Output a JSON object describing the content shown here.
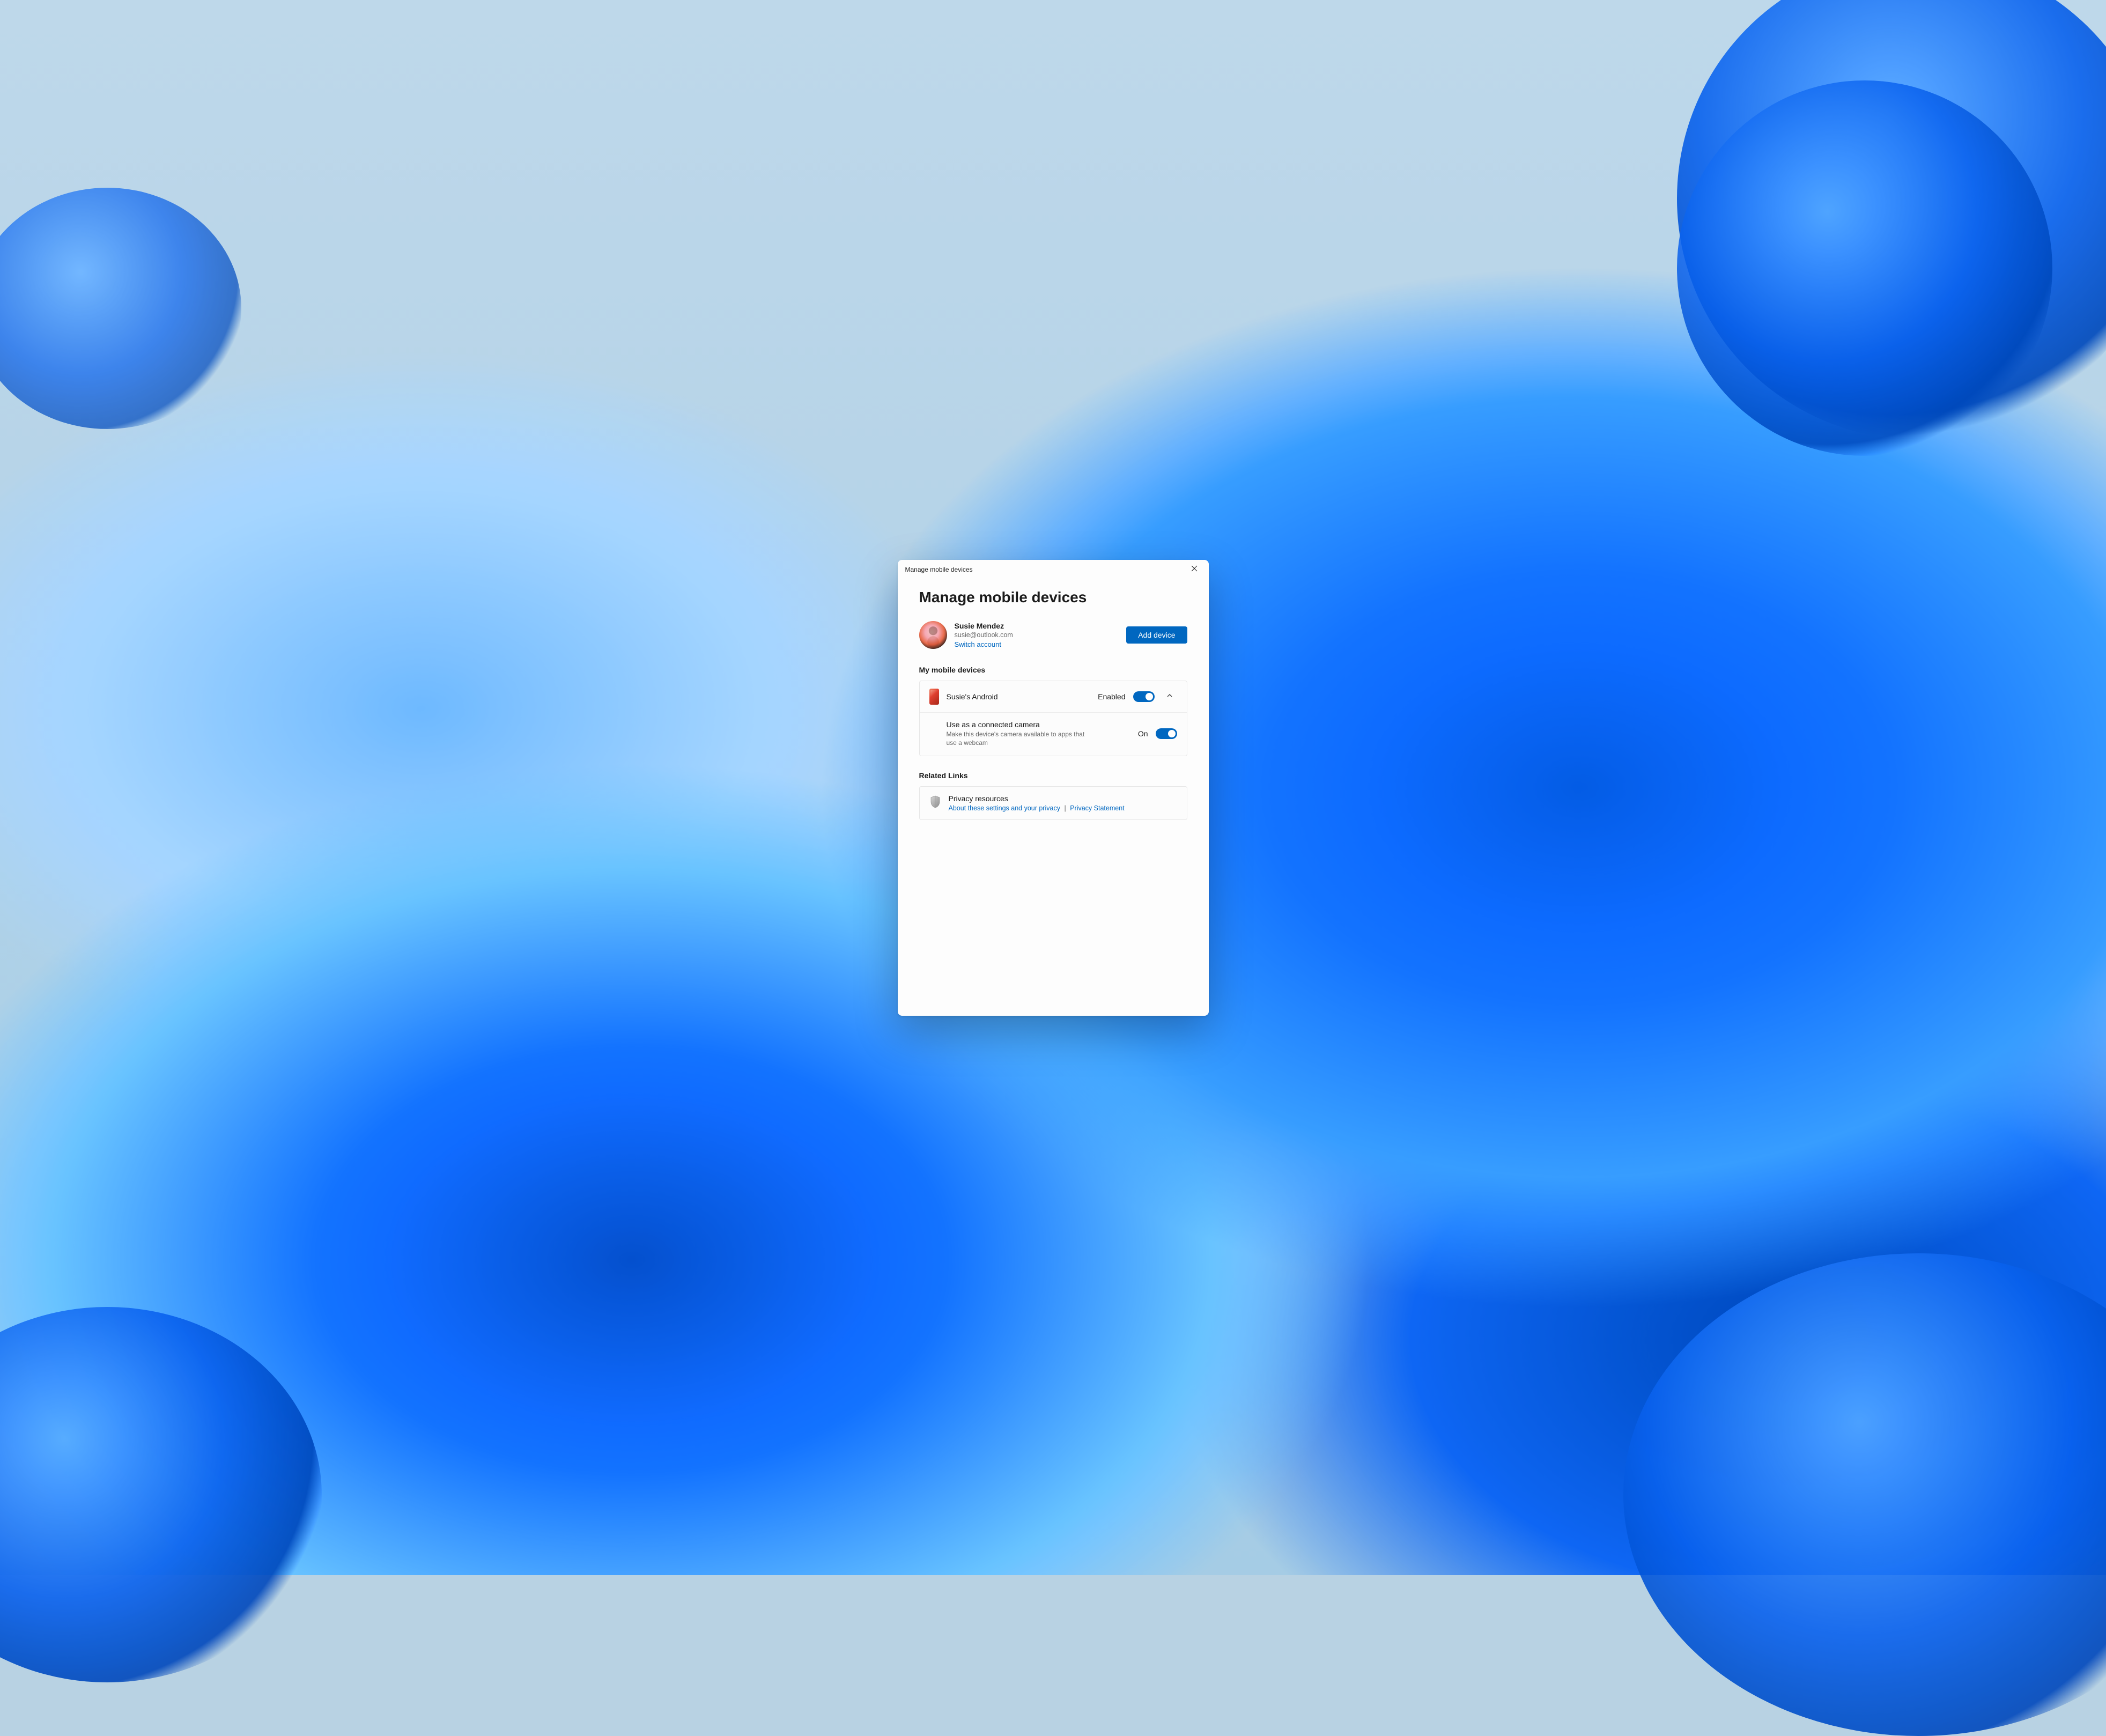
{
  "window": {
    "title": "Manage mobile devices"
  },
  "page": {
    "heading": "Manage mobile devices"
  },
  "account": {
    "name": "Susie Mendez",
    "email": "susie@outlook.com",
    "switch_label": "Switch account",
    "add_device_label": "Add device"
  },
  "devices": {
    "section_label": "My mobile devices",
    "items": [
      {
        "name": "Susie's Android",
        "status_label": "Enabled",
        "enabled": true,
        "expanded": true,
        "settings": [
          {
            "title": "Use as a connected camera",
            "description": "Make this device's camera available to apps that use a webcam",
            "status_label": "On",
            "on": true
          }
        ]
      }
    ]
  },
  "related": {
    "section_label": "Related Links",
    "privacy": {
      "title": "Privacy resources",
      "link1": "About these settings and your privacy",
      "separator": "|",
      "link2": "Privacy Statement"
    }
  }
}
